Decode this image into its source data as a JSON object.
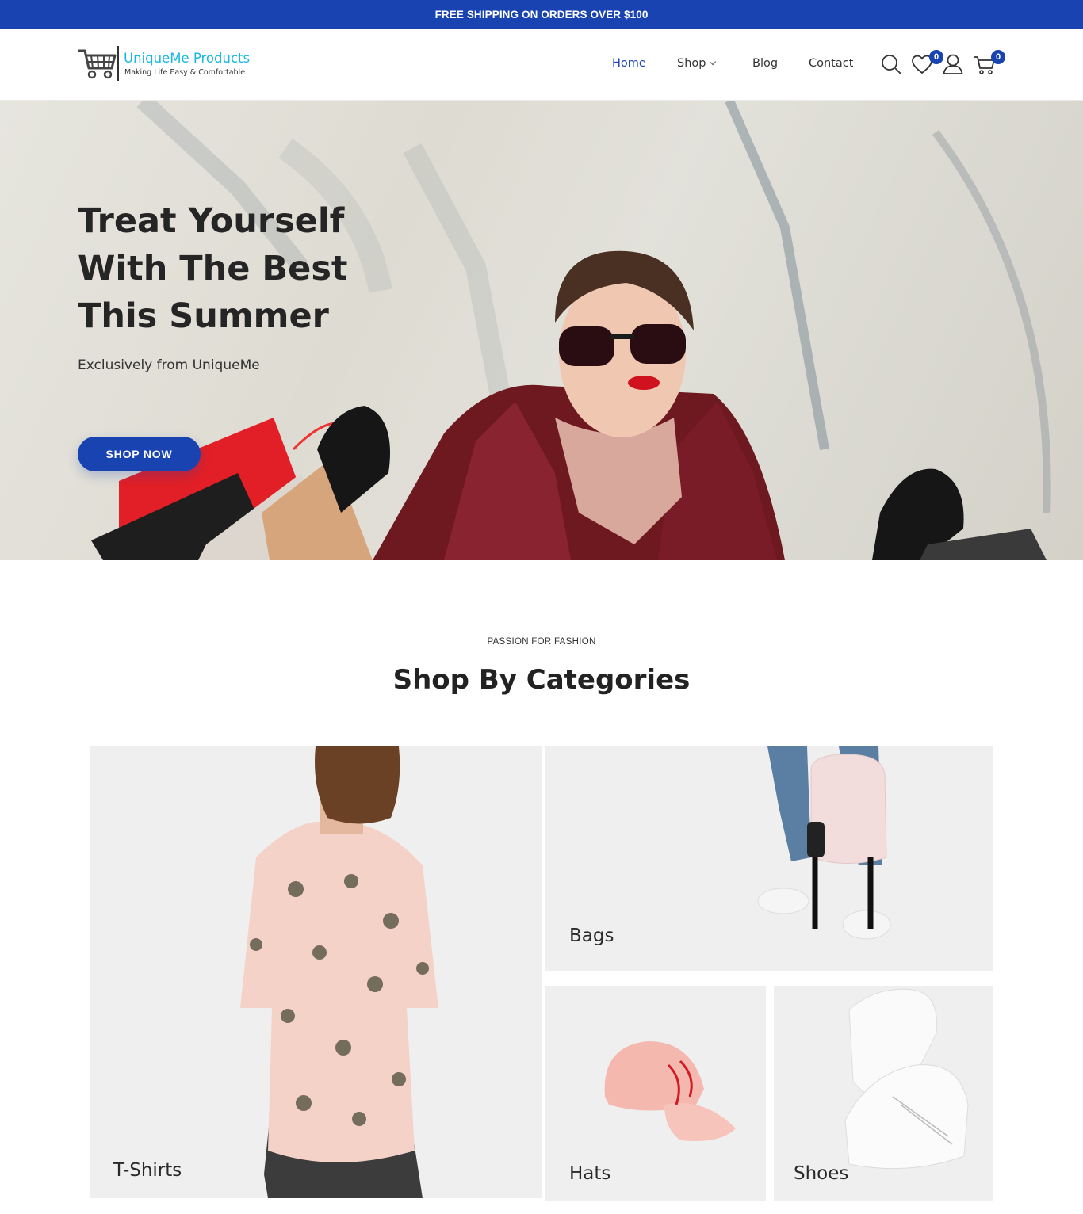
{
  "announcement": "FREE SHIPPING ON ORDERS OVER $100",
  "logo": {
    "brand": "UniqueMe Products",
    "tagline": "Making Life Easy & Comfortable"
  },
  "nav": {
    "items": [
      {
        "label": "Home",
        "active": true
      },
      {
        "label": "Shop",
        "has_dropdown": true
      },
      {
        "label": "Blog"
      },
      {
        "label": "Contact"
      }
    ]
  },
  "header_icons": {
    "search": "search-icon",
    "wishlist": "heart-icon",
    "wishlist_count": "0",
    "account": "user-icon",
    "cart": "cart-icon",
    "cart_count": "0"
  },
  "hero": {
    "title_lines": [
      "Treat Yourself",
      "With The Best",
      "This Summer"
    ],
    "subtitle": "Exclusively from UniqueMe",
    "cta": "SHOP NOW"
  },
  "categories_section": {
    "eyebrow": "PASSION FOR FASHION",
    "title": "Shop By Categories",
    "items": [
      {
        "label": "T-Shirts"
      },
      {
        "label": "Bags"
      },
      {
        "label": "Hats"
      },
      {
        "label": "Shoes"
      }
    ]
  },
  "colors": {
    "brand_blue": "#1843b1",
    "logo_cyan": "#19b8e0",
    "text_dark": "#252525"
  }
}
